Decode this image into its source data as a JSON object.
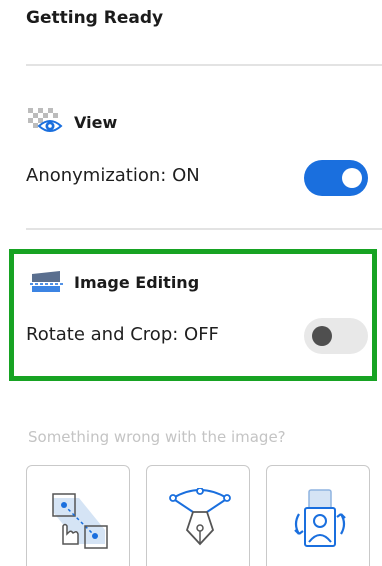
{
  "header": {
    "title": "Getting Ready"
  },
  "view": {
    "heading": "View",
    "icon": "anonymize-eye-icon",
    "setting_label": "Anonymization: ON",
    "toggle_on": true
  },
  "image_editing": {
    "heading": "Image Editing",
    "icon": "image-editing-icon",
    "setting_label": "Rotate and Crop: OFF",
    "toggle_on": false
  },
  "help": {
    "hint": "Something wrong with the image?",
    "tools": [
      {
        "icon": "point-select-icon"
      },
      {
        "icon": "curve-pen-icon"
      },
      {
        "icon": "rotate-portrait-icon"
      }
    ]
  },
  "colors": {
    "accent_blue": "#1a6fde",
    "highlight_green": "#17a323",
    "hint_gray": "#c4c4c4"
  }
}
